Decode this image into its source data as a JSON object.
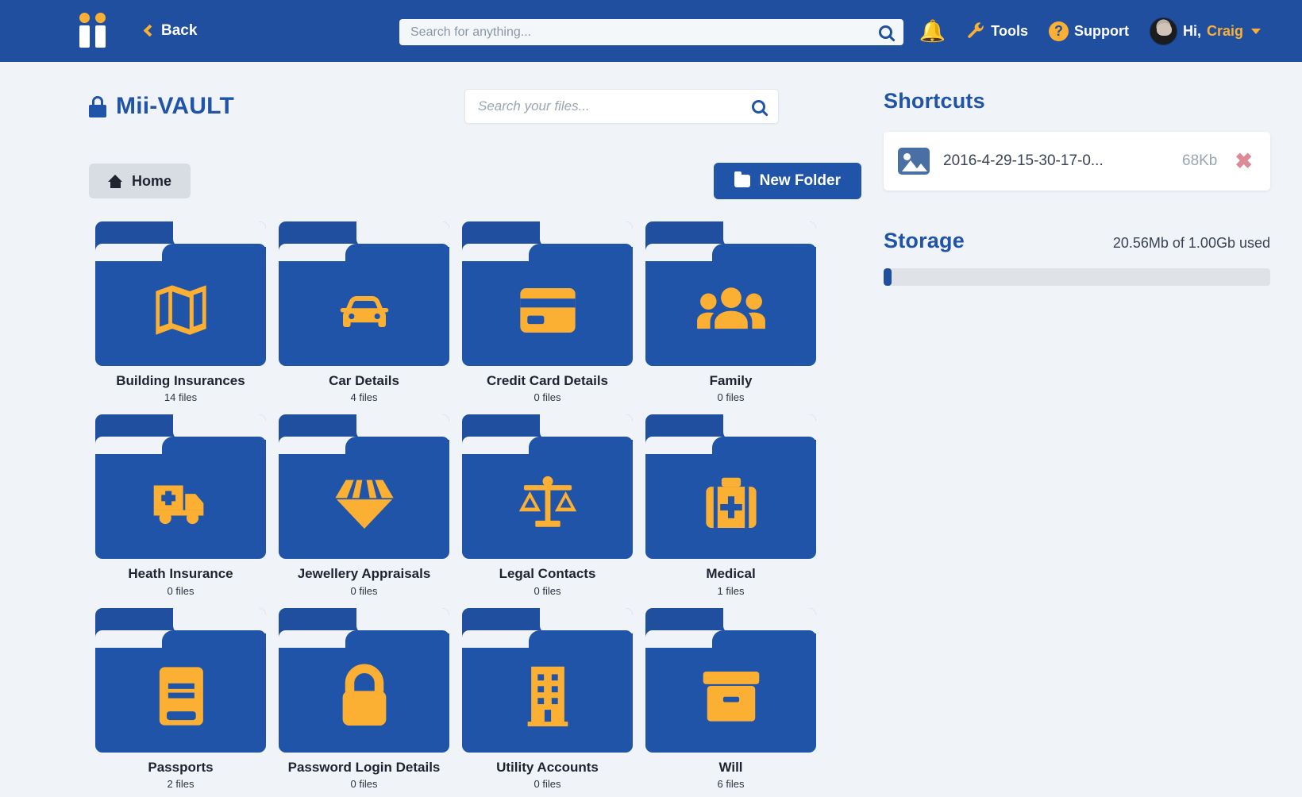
{
  "brand": {
    "logo_icon": "double-bar-logo"
  },
  "topbar": {
    "back_label": "Back",
    "search_placeholder": "Search for anything...",
    "search_value": "",
    "search_icon": "search-icon",
    "bell_icon": "bell-icon",
    "tools_label": "Tools",
    "tools_icon": "wrench-icon",
    "support_label": "Support",
    "support_icon": "question-circle-icon",
    "greeting": "Hi,",
    "user_name": "Craig",
    "caret_icon": "chevron-down-icon"
  },
  "vault": {
    "title": "Mii-VAULT",
    "lock_icon": "lock-icon",
    "file_search_placeholder": "Search your files...",
    "file_search_value": "",
    "file_search_icon": "search-icon"
  },
  "toolbar": {
    "home_label": "Home",
    "home_icon": "home-icon",
    "new_folder_label": "New Folder",
    "new_folder_icon": "folder-icon"
  },
  "folders": [
    {
      "name": "Building Insurances",
      "files": "14 files",
      "icon": "map-icon"
    },
    {
      "name": "Car Details",
      "files": "4 files",
      "icon": "car-icon"
    },
    {
      "name": "Credit Card Details",
      "files": "0 files",
      "icon": "credit-card-icon"
    },
    {
      "name": "Family",
      "files": "0 files",
      "icon": "users-icon"
    },
    {
      "name": "Heath Insurance",
      "files": "0 files",
      "icon": "ambulance-icon"
    },
    {
      "name": "Jewellery Appraisals",
      "files": "0 files",
      "icon": "gem-icon"
    },
    {
      "name": "Legal Contacts",
      "files": "0 files",
      "icon": "balance-scale-icon"
    },
    {
      "name": "Medical",
      "files": "1 files",
      "icon": "medkit-icon"
    },
    {
      "name": "Passports",
      "files": "2 files",
      "icon": "book-icon"
    },
    {
      "name": "Password Login Details",
      "files": "0 files",
      "icon": "padlock-icon"
    },
    {
      "name": "Utility Accounts",
      "files": "0 files",
      "icon": "building-icon"
    },
    {
      "name": "Will",
      "files": "6 files",
      "icon": "archive-box-icon"
    }
  ],
  "sidebar": {
    "shortcuts_title": "Shortcuts",
    "shortcuts": [
      {
        "name": "2016-4-29-15-30-17-0...",
        "size": "68Kb",
        "icon": "image-icon",
        "delete_icon": "close-icon"
      }
    ],
    "storage_title": "Storage",
    "storage_used_label": "20.56Mb of 1.00Gb used",
    "storage_percent": 2
  },
  "colors": {
    "nav_blue": "#1f4f9e",
    "folder_blue": "#1f54a8",
    "accent_orange": "#fbb034",
    "page_bg": "#f0f4f8",
    "delete_red": "#dc8a95"
  }
}
